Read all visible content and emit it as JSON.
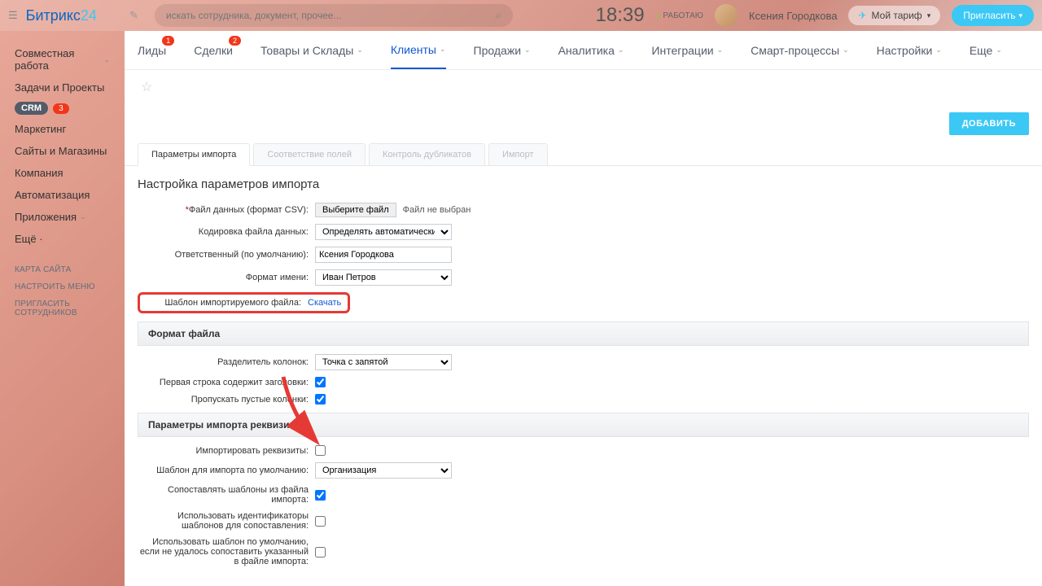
{
  "brand": {
    "name": "Битрикс",
    "suffix": "24"
  },
  "search": {
    "placeholder": "искать сотрудника, документ, прочее..."
  },
  "header": {
    "time": "18:39",
    "work_status": "РАБОТАЮ",
    "username": "Ксения Городкова",
    "tariff": "Мой тариф",
    "invite": "Пригласить"
  },
  "sidebar": {
    "items": [
      {
        "label": "Совместная работа",
        "chev": true
      },
      {
        "label": "Задачи и Проекты"
      }
    ],
    "crm": {
      "label": "CRM",
      "count": "3"
    },
    "items2": [
      {
        "label": "Маркетинг"
      },
      {
        "label": "Сайты и Магазины"
      },
      {
        "label": "Компания"
      },
      {
        "label": "Автоматизация"
      },
      {
        "label": "Приложения",
        "chev": true
      },
      {
        "label": "Ещё ·"
      }
    ],
    "small": [
      "КАРТА САЙТА",
      "НАСТРОИТЬ МЕНЮ",
      "ПРИГЛАСИТЬ СОТРУДНИКОВ"
    ]
  },
  "topnav": [
    {
      "label": "Лиды",
      "badge": "1"
    },
    {
      "label": "Сделки",
      "badge": "2"
    },
    {
      "label": "Товары и Склады",
      "chev": true
    },
    {
      "label": "Клиенты",
      "chev": true,
      "active": true
    },
    {
      "label": "Продажи",
      "chev": true
    },
    {
      "label": "Аналитика",
      "chev": true
    },
    {
      "label": "Интеграции",
      "chev": true
    },
    {
      "label": "Смарт-процессы",
      "chev": true
    },
    {
      "label": "Настройки",
      "chev": true
    },
    {
      "label": "Еще",
      "chev": true
    }
  ],
  "actions": {
    "add": "ДОБАВИТЬ"
  },
  "tabs": [
    {
      "label": "Параметры импорта",
      "on": true
    },
    {
      "label": "Соответствие полей"
    },
    {
      "label": "Контроль дубликатов"
    },
    {
      "label": "Импорт"
    }
  ],
  "page": {
    "title": "Настройка параметров импорта",
    "file_label": "Файл данных (формат CSV):",
    "file_button": "Выберите файл",
    "file_status": "Файл не выбран",
    "encoding_label": "Кодировка файла данных:",
    "encoding_value": "Определять автоматически",
    "responsible_label": "Ответственный (по умолчанию):",
    "responsible_value": "Ксения Городкова",
    "nameformat_label": "Формат имени:",
    "nameformat_value": "Иван Петров",
    "template_label": "Шаблон импортируемого файла:",
    "template_link": "Скачать",
    "section_fileformat": "Формат файла",
    "delimiter_label": "Разделитель колонок:",
    "delimiter_value": "Точка с запятой",
    "firstrow_label": "Первая строка содержит заголовки:",
    "skipempty_label": "Пропускать пустые колонки:",
    "section_requisites": "Параметры импорта реквизитов",
    "import_req_label": "Импортировать реквизиты:",
    "default_tpl_label": "Шаблон для импорта по умолчанию:",
    "default_tpl_value": "Организация",
    "match_tpl_label": "Сопоставлять шаблоны из файла импорта:",
    "use_ids_label": "Использовать идентификаторы шаблонов для сопоставления:",
    "use_default_label": "Использовать шаблон по умолчанию, если не удалось сопоставить указанный в файле импорта:"
  }
}
